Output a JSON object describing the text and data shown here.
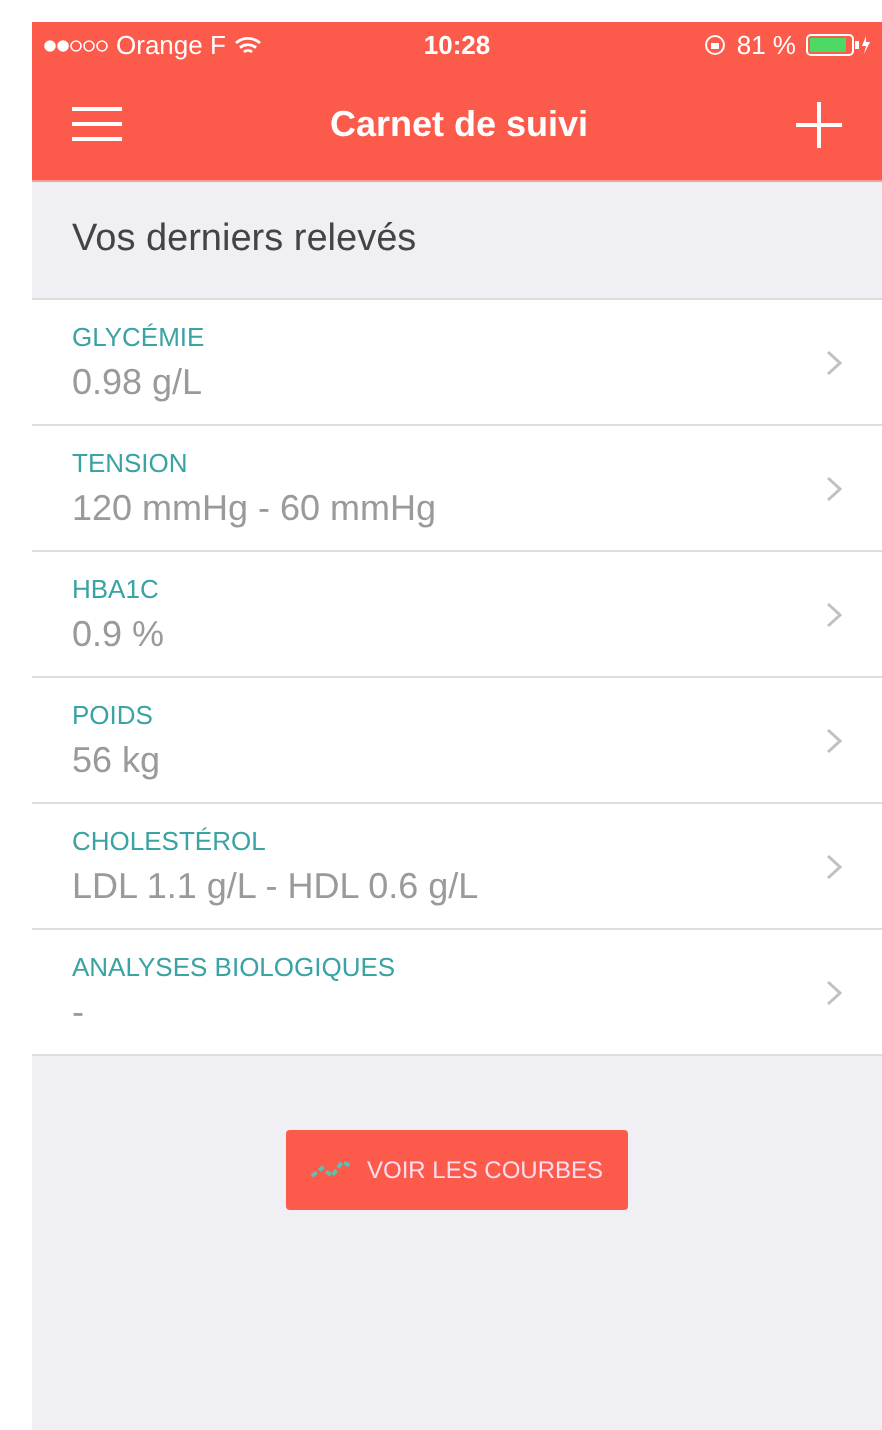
{
  "status_bar": {
    "carrier": "Orange F",
    "time": "10:28",
    "battery": "81 %"
  },
  "nav_bar": {
    "title": "Carnet de suivi"
  },
  "section": {
    "title": "Vos derniers relevés"
  },
  "readings": [
    {
      "label": "GLYCÉMIE",
      "value": "0.98 g/L"
    },
    {
      "label": "TENSION",
      "value": "120 mmHg - 60 mmHg"
    },
    {
      "label": "HBA1C",
      "value": "0.9 %"
    },
    {
      "label": "POIDS",
      "value": "56 kg"
    },
    {
      "label": "CHOLESTÉROL",
      "value": "LDL 1.1 g/L - HDL 0.6 g/L"
    },
    {
      "label": "ANALYSES BIOLOGIQUES",
      "value": "-"
    }
  ],
  "button": {
    "label": "VOIR LES COURBES"
  }
}
